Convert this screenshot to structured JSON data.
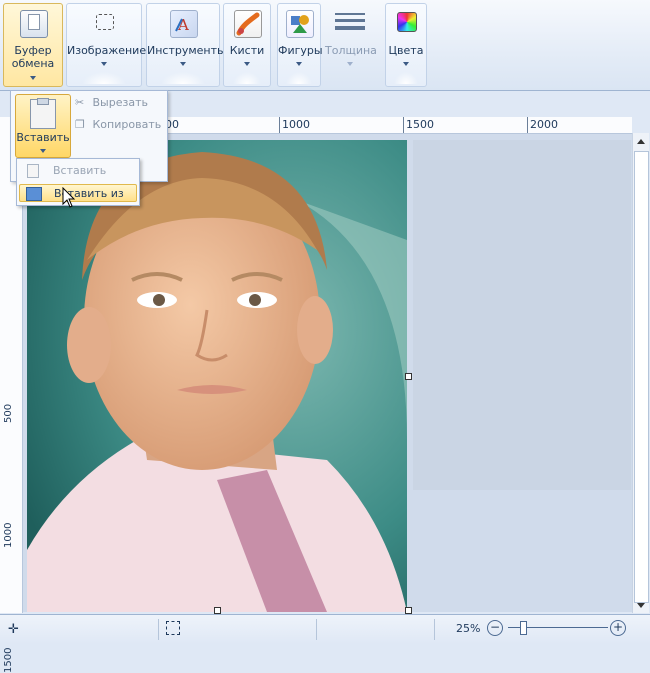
{
  "ribbon": {
    "groups": [
      {
        "label": "Буфер обмена",
        "icon": "clipboard-icon"
      },
      {
        "label": "Изображение",
        "icon": "select-icon"
      },
      {
        "label": "Инструменты",
        "icon": "tools-icon"
      },
      {
        "label": "Кисти",
        "icon": "brush-icon"
      },
      {
        "label": "Фигуры",
        "icon": "shapes-icon"
      },
      {
        "label": "Толщина",
        "icon": "thickness-icon"
      },
      {
        "label": "Цвета",
        "icon": "colors-icon"
      }
    ]
  },
  "clipboard": {
    "paste_label": "Вставить",
    "cut_label": "Вырезать",
    "copy_label": "Копировать"
  },
  "paste_menu": {
    "items": [
      {
        "label": "Вставить"
      },
      {
        "label": "Вставить из"
      }
    ]
  },
  "ruler": {
    "h_ticks": [
      "00",
      "1000",
      "1500",
      "2000"
    ],
    "v_ticks": [
      "500",
      "1000",
      "1500"
    ]
  },
  "status": {
    "zoom": "25%"
  },
  "colors": {
    "accent": "#ffd766",
    "ribbon_border": "#9fb4d1"
  }
}
